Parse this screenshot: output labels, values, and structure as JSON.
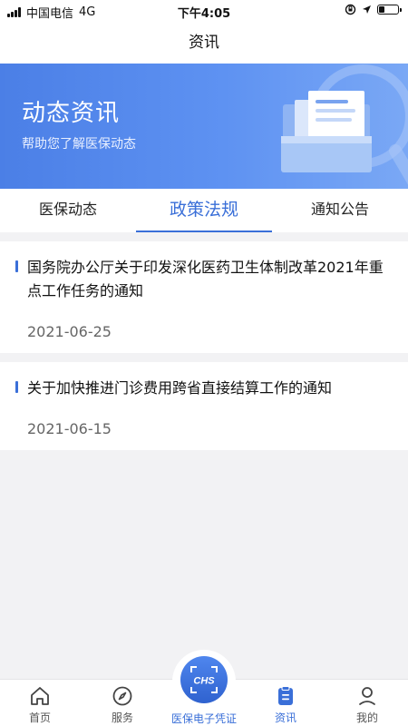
{
  "status_bar": {
    "carrier": "中国电信",
    "network": "4G",
    "time": "下午4:05",
    "battery_level": 0.25
  },
  "header": {
    "title": "资讯"
  },
  "banner": {
    "title": "动态资讯",
    "subtitle": "帮助您了解医保动态"
  },
  "tabs": [
    {
      "label": "医保动态",
      "active": false
    },
    {
      "label": "政策法规",
      "active": true
    },
    {
      "label": "通知公告",
      "active": false
    }
  ],
  "news": [
    {
      "title": "国务院办公厅关于印发深化医药卫生体制改革2021年重点工作任务的通知",
      "date": "2021-06-25"
    },
    {
      "title": "关于加快推进门诊费用跨省直接结算工作的通知",
      "date": "2021-06-15"
    }
  ],
  "bottom_nav": {
    "items": [
      {
        "label": "首页",
        "icon": "home-icon"
      },
      {
        "label": "服务",
        "icon": "compass-icon"
      },
      {
        "label": "医保电子凭证",
        "icon": "chs-logo-icon",
        "badge_text": "CHS"
      },
      {
        "label": "资讯",
        "icon": "news-icon",
        "active": true
      },
      {
        "label": "我的",
        "icon": "user-icon"
      }
    ]
  },
  "colors": {
    "accent": "#3a6fd8",
    "banner_start": "#4b7fe6",
    "banner_end": "#7aa8f5"
  }
}
